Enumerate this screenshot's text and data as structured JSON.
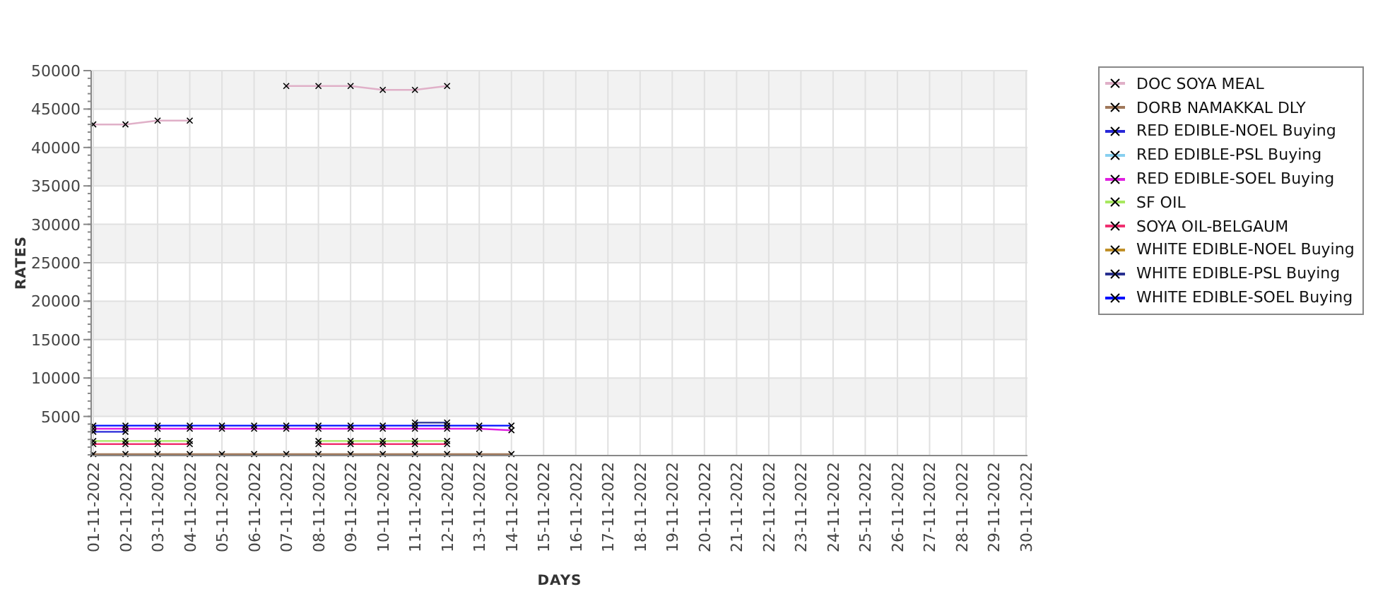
{
  "chart_data": {
    "type": "line",
    "xlabel": "DAYS",
    "ylabel": "RATES",
    "grid": true,
    "categories": [
      "01-11-2022",
      "02-11-2022",
      "03-11-2022",
      "04-11-2022",
      "05-11-2022",
      "06-11-2022",
      "07-11-2022",
      "08-11-2022",
      "09-11-2022",
      "10-11-2022",
      "11-11-2022",
      "12-11-2022",
      "13-11-2022",
      "14-11-2022",
      "15-11-2022",
      "16-11-2022",
      "17-11-2022",
      "18-11-2022",
      "19-11-2022",
      "20-11-2022",
      "21-11-2022",
      "22-11-2022",
      "23-11-2022",
      "24-11-2022",
      "25-11-2022",
      "26-11-2022",
      "27-11-2022",
      "28-11-2022",
      "29-11-2022",
      "30-11-2022"
    ],
    "ylim": [
      0,
      50000
    ],
    "yticks": [
      5000,
      10000,
      15000,
      20000,
      25000,
      30000,
      35000,
      40000,
      45000,
      50000
    ],
    "series": [
      {
        "name": "DOC SOYA MEAL",
        "color": "#e0b0c8",
        "marker": "cross",
        "values": [
          43000,
          43000,
          43500,
          43500,
          null,
          null,
          48000,
          48000,
          48000,
          47500,
          47500,
          48000,
          null,
          null,
          null,
          null,
          null,
          null,
          null,
          null,
          null,
          null,
          null,
          null,
          null,
          null,
          null,
          null,
          null,
          null
        ]
      },
      {
        "name": "DORB NAMAKKAL DLY",
        "color": "#a0785a",
        "marker": "cross",
        "values": [
          100,
          100,
          100,
          100,
          100,
          100,
          100,
          100,
          100,
          100,
          100,
          100,
          100,
          100,
          null,
          null,
          null,
          null,
          null,
          null,
          null,
          null,
          null,
          null,
          null,
          null,
          null,
          null,
          null,
          null
        ]
      },
      {
        "name": "RED EDIBLE-NOEL Buying",
        "color": "#2828d8",
        "marker": "cross",
        "values": [
          3000,
          3000,
          null,
          null,
          null,
          null,
          null,
          null,
          null,
          null,
          null,
          null,
          null,
          null,
          null,
          null,
          null,
          null,
          null,
          null,
          null,
          null,
          null,
          null,
          null,
          null,
          null,
          null,
          null,
          null
        ]
      },
      {
        "name": "RED EDIBLE-PSL Buying",
        "color": "#88d0f0",
        "values": [
          null,
          null,
          null,
          null,
          null,
          null,
          null,
          null,
          null,
          null,
          null,
          null,
          null,
          null,
          null,
          null,
          null,
          null,
          null,
          null,
          null,
          null,
          null,
          null,
          null,
          null,
          null,
          null,
          null,
          null
        ]
      },
      {
        "name": "RED EDIBLE-SOEL Buying",
        "color": "#e020e0",
        "marker": "cross",
        "values": [
          3400,
          3400,
          3400,
          3400,
          3400,
          3400,
          3400,
          3400,
          3400,
          3400,
          3400,
          3400,
          3400,
          3200,
          null,
          null,
          null,
          null,
          null,
          null,
          null,
          null,
          null,
          null,
          null,
          null,
          null,
          null,
          null,
          null
        ]
      },
      {
        "name": "SF OIL",
        "color": "#a8e860",
        "marker": "cross",
        "values": [
          1800,
          1800,
          1800,
          1800,
          null,
          null,
          null,
          1800,
          1800,
          1800,
          1800,
          1800,
          null,
          null,
          null,
          null,
          null,
          null,
          null,
          null,
          null,
          null,
          null,
          null,
          null,
          null,
          null,
          null,
          null,
          null
        ]
      },
      {
        "name": "SOYA OIL-BELGAUM",
        "color": "#f03070",
        "marker": "cross",
        "values": [
          1400,
          1400,
          1400,
          1400,
          null,
          null,
          null,
          1400,
          1400,
          1400,
          1400,
          1400,
          null,
          null,
          null,
          null,
          null,
          null,
          null,
          null,
          null,
          null,
          null,
          null,
          null,
          null,
          null,
          null,
          null,
          null
        ]
      },
      {
        "name": "WHITE EDIBLE-NOEL Buying",
        "color": "#c09028",
        "values": [
          null,
          null,
          null,
          null,
          null,
          null,
          null,
          null,
          null,
          null,
          null,
          null,
          null,
          null,
          null,
          null,
          null,
          null,
          null,
          null,
          null,
          null,
          null,
          null,
          null,
          null,
          null,
          null,
          null,
          null
        ]
      },
      {
        "name": "WHITE EDIBLE-PSL Buying",
        "color": "#283090",
        "marker": "cross",
        "values": [
          null,
          null,
          null,
          null,
          null,
          null,
          null,
          null,
          null,
          null,
          4200,
          4200,
          null,
          null,
          null,
          null,
          null,
          null,
          null,
          null,
          null,
          null,
          null,
          null,
          null,
          null,
          null,
          null,
          null,
          null
        ]
      },
      {
        "name": "WHITE EDIBLE-SOEL Buying",
        "color": "#0010ff",
        "marker": "cross",
        "values": [
          3800,
          3800,
          3800,
          3800,
          3800,
          3800,
          3800,
          3800,
          3800,
          3800,
          3800,
          3800,
          3800,
          3800,
          null,
          null,
          null,
          null,
          null,
          null,
          null,
          null,
          null,
          null,
          null,
          null,
          null,
          null,
          null,
          null
        ]
      }
    ]
  }
}
